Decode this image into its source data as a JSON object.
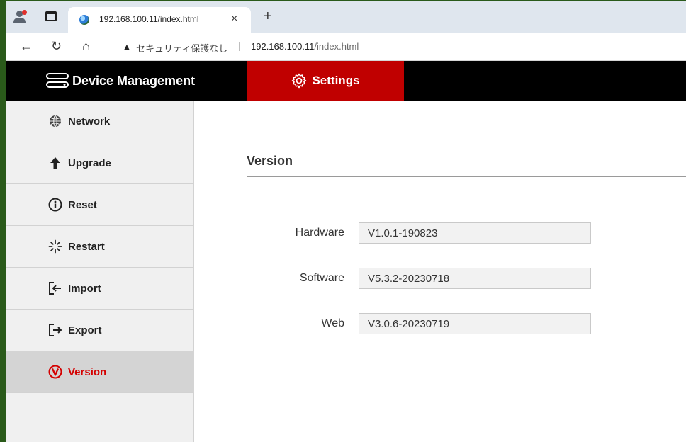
{
  "browser": {
    "tab_title": "192.168.100.11/index.html",
    "close_glyph": "×",
    "new_tab_glyph": "+",
    "security_text": "セキュリティ保護なし",
    "separator": "|",
    "url_host": "192.168.100.11",
    "url_path": "/index.html"
  },
  "header": {
    "brand": "Device Management",
    "active_tab": "Settings",
    "accent_color": "#c00000"
  },
  "sidebar": {
    "items": [
      {
        "label": "Network",
        "icon": "globe-icon"
      },
      {
        "label": "Upgrade",
        "icon": "arrow-up-icon"
      },
      {
        "label": "Reset",
        "icon": "info-icon"
      },
      {
        "label": "Restart",
        "icon": "spinner-icon"
      },
      {
        "label": "Import",
        "icon": "import-icon"
      },
      {
        "label": "Export",
        "icon": "export-icon"
      },
      {
        "label": "Version",
        "icon": "version-icon",
        "active": true
      }
    ]
  },
  "content": {
    "title": "Version",
    "fields": [
      {
        "label": "Hardware",
        "value": "V1.0.1-190823"
      },
      {
        "label": "Software",
        "value": "V5.3.2-20230718"
      },
      {
        "label": "Web",
        "value": "V3.0.6-20230719"
      }
    ]
  }
}
